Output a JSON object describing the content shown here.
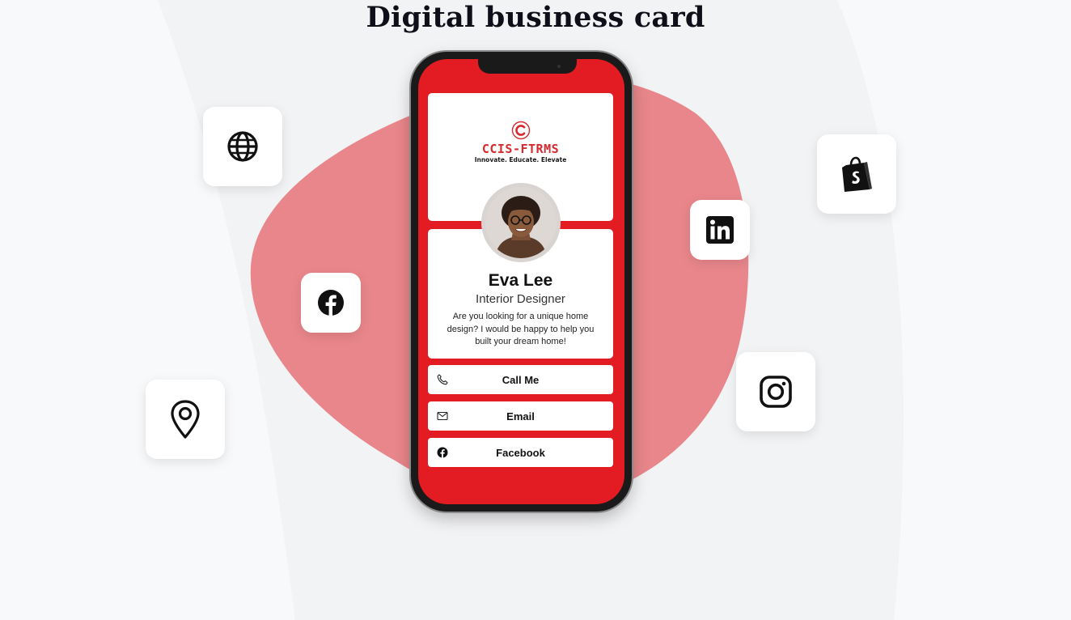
{
  "page": {
    "title": "Digital business card"
  },
  "colors": {
    "brand_red": "#e31b23",
    "blob": "#e8868b",
    "logo_red": "#d62a2f"
  },
  "icons": {
    "globe": "globe-icon",
    "facebook": "facebook-icon",
    "location": "location-pin-icon",
    "linkedin": "linkedin-icon",
    "shopify": "shopify-icon",
    "instagram": "instagram-icon"
  },
  "card": {
    "logo": {
      "name": "CCIS-FTRMS",
      "tagline": "Innovate. Educate. Elevate"
    },
    "person": {
      "name": "Eva Lee",
      "role": "Interior Designer",
      "bio": "Are you looking for a unique home design? I would be happy to help you built your dream home!"
    },
    "actions": [
      {
        "label": "Call Me",
        "icon": "phone-icon"
      },
      {
        "label": "Email",
        "icon": "mail-icon"
      },
      {
        "label": "Facebook",
        "icon": "facebook-icon"
      }
    ]
  }
}
